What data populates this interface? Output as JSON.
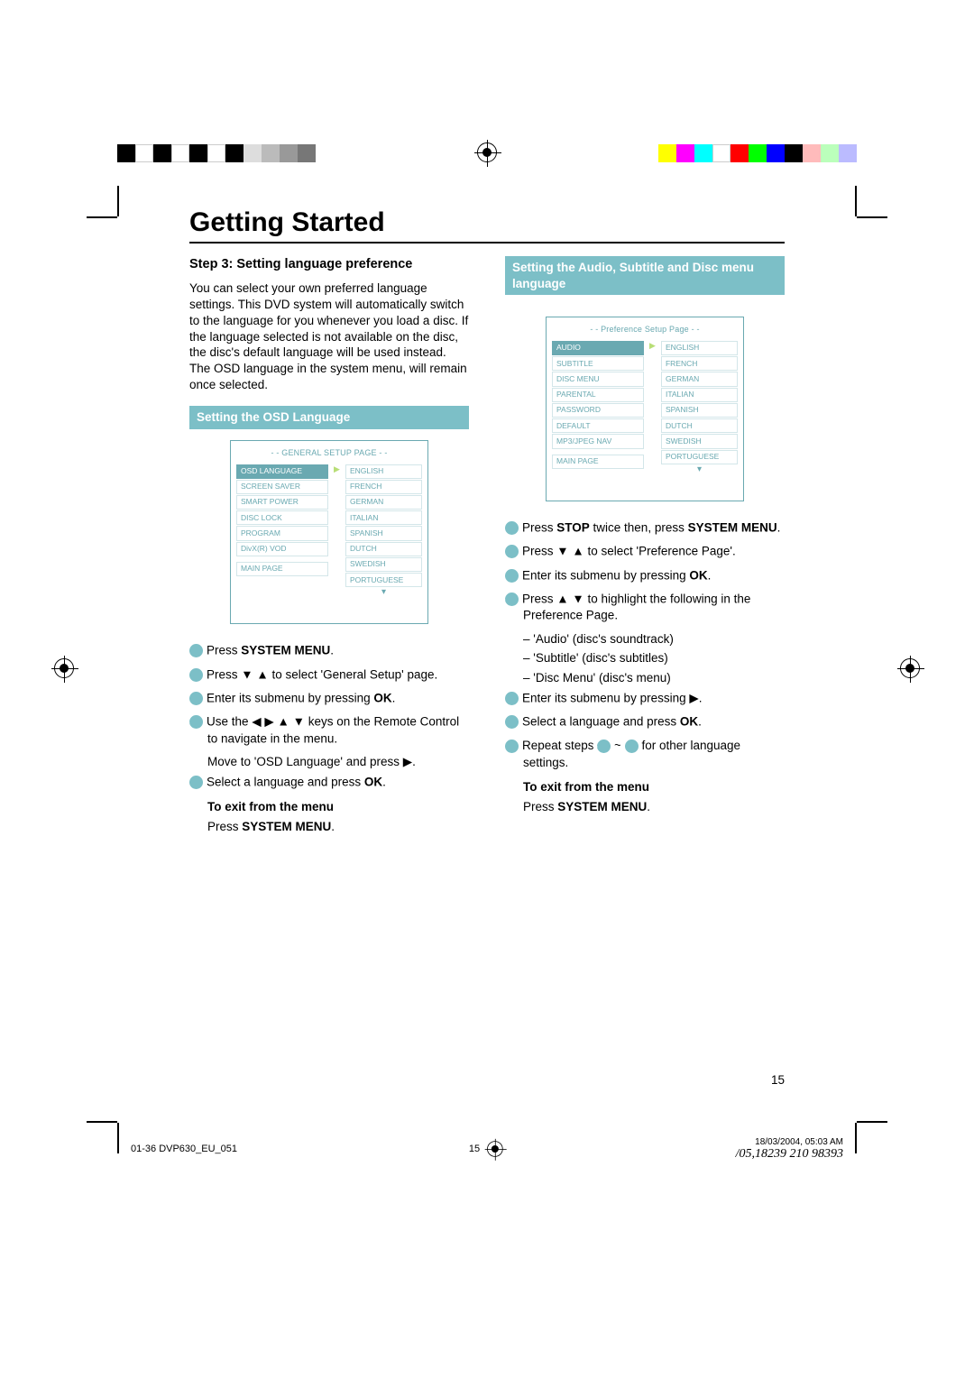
{
  "header": {
    "title": "Getting Started"
  },
  "left": {
    "step_head": "Step 3:  Setting language preference",
    "intro": "You can select your own preferred language settings. This DVD system will automatically switch to the language for you whenever you load a disc.  If the language selected is not available on the disc, the disc's default language will be used instead.  The OSD language in the system menu, will remain once selected.",
    "bar": "Setting the OSD Language",
    "osd": {
      "title": "- - GENERAL SETUP PAGE - -",
      "left_items": [
        "OSD LANGUAGE",
        "SCREEN SAVER",
        "SMART POWER",
        "DISC LOCK",
        "PROGRAM",
        "DivX(R) VOD"
      ],
      "main": "MAIN PAGE",
      "right_items": [
        "ENGLISH",
        "FRENCH",
        "GERMAN",
        "ITALIAN",
        "SPANISH",
        "DUTCH",
        "SWEDISH",
        "PORTUGUESE"
      ]
    },
    "steps": {
      "s1a": "Press ",
      "s1b": "SYSTEM MENU",
      "s1c": ".",
      "s2a": "Press ▼ ▲ to select 'General Setup' page.",
      "s3a": "Enter its submenu by pressing ",
      "s3b": "OK",
      "s3c": ".",
      "s4a": "Use the ◀ ▶ ▲ ▼ keys on the Remote Control to navigate in the menu.",
      "s4b": "Move to 'OSD Language' and press ▶.",
      "s5a": "Select a language and press ",
      "s5b": "OK",
      "s5c": "."
    },
    "exit_head": "To exit from the menu",
    "exit_body_a": "Press ",
    "exit_body_b": "SYSTEM MENU",
    "exit_body_c": "."
  },
  "right": {
    "bar": "Setting the Audio, Subtitle and Disc menu language",
    "osd": {
      "title": "- - Preference Setup Page - -",
      "left_items": [
        "AUDIO",
        "SUBTITLE",
        "DISC MENU",
        "PARENTAL",
        "PASSWORD",
        "DEFAULT",
        "MP3/JPEG NAV"
      ],
      "main": "MAIN PAGE",
      "right_items": [
        "ENGLISH",
        "FRENCH",
        "GERMAN",
        "ITALIAN",
        "SPANISH",
        "DUTCH",
        "SWEDISH",
        "PORTUGUESE"
      ]
    },
    "steps": {
      "s1a": "Press ",
      "s1b": "STOP",
      "s1c": " twice then, press ",
      "s1d": "SYSTEM MENU",
      "s1e": ".",
      "s2a": "Press ▼ ▲ to select 'Preference Page'.",
      "s3a": "Enter its submenu by pressing ",
      "s3b": "OK",
      "s3c": ".",
      "s4a": "Press ▲ ▼ to highlight the following in the Preference Page.",
      "s4_items": [
        "'Audio' (disc's soundtrack)",
        "'Subtitle' (disc's subtitles)",
        "'Disc Menu' (disc's menu)"
      ],
      "s5a": "Enter its submenu by pressing ▶.",
      "s6a": "Select a language and press ",
      "s6b": "OK",
      "s6c": ".",
      "s7a": "Repeat steps ",
      "s7b": " ~ ",
      "s7c": " for other language settings."
    },
    "exit_head": "To exit from the menu",
    "exit_body_a": "Press ",
    "exit_body_b": "SYSTEM MENU",
    "exit_body_c": "."
  },
  "page_number": "15",
  "footer": {
    "left": "01-36 DVP630_EU_051",
    "center": "15",
    "right_date": "18/03/2004, 05:03 AM",
    "right_id": "/05,18239 210 98393"
  },
  "colorbars": {
    "left": [
      "#000",
      "#fff",
      "#000",
      "#fff",
      "#000",
      "#fff",
      "#000",
      "#ddd",
      "#bbb",
      "#999",
      "#777",
      "#fff"
    ],
    "right": [
      "#ff0",
      "#f0f",
      "#0ff",
      "#fff",
      "#f00",
      "#0f0",
      "#00f",
      "#000",
      "#fbb",
      "#bfb",
      "#bbf",
      "#fff"
    ]
  }
}
